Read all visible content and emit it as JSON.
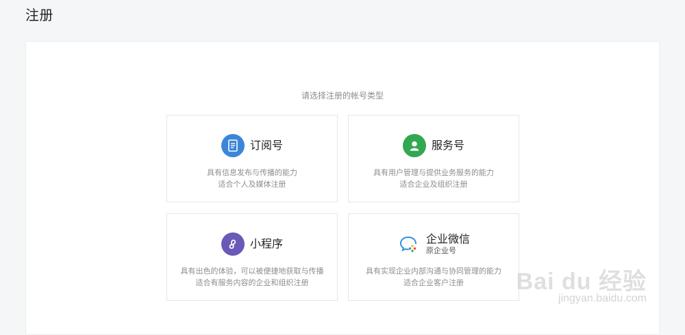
{
  "page": {
    "title": "注册"
  },
  "panel": {
    "prompt": "请选择注册的帐号类型"
  },
  "cards": [
    {
      "title": "订阅号",
      "icon": "document-icon",
      "icon_color": "#3b86d9",
      "desc_line1": "具有信息发布与传播的能力",
      "desc_line2": "适合个人及媒体注册"
    },
    {
      "title": "服务号",
      "icon": "user-icon",
      "icon_color": "#33a752",
      "desc_line1": "具有用户管理与提供业务服务的能力",
      "desc_line2": "适合企业及组织注册"
    },
    {
      "title": "小程序",
      "icon": "mini-program-icon",
      "icon_color": "#6b59b7",
      "desc_line1": "具有出色的体验，可以被便捷地获取与传播",
      "desc_line2": "适合有服务内容的企业和组织注册"
    },
    {
      "title": "企业微信",
      "subtitle": "原企业号",
      "icon": "wecom-icon",
      "desc_line1": "具有实现企业内部沟通与协同管理的能力",
      "desc_line2": "适合企业客户注册"
    }
  ],
  "watermark": {
    "brand": "Bai du 经验",
    "url": "jingyan.baidu.com"
  }
}
